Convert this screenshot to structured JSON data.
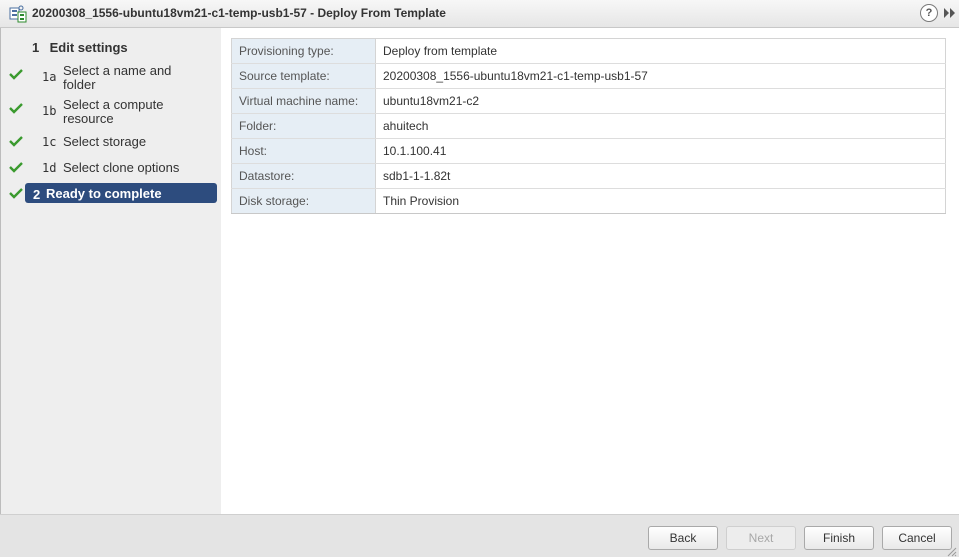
{
  "window": {
    "title": "20200308_1556-ubuntu18vm21-c1-temp-usb1-57 - Deploy From Template",
    "help_label": "?"
  },
  "sidebar": {
    "group": {
      "number": "1",
      "label": "Edit settings"
    },
    "steps": [
      {
        "number": "1a",
        "label": "Select a name and folder",
        "completed": true
      },
      {
        "number": "1b",
        "label": "Select a compute resource",
        "completed": true
      },
      {
        "number": "1c",
        "label": "Select storage",
        "completed": true
      },
      {
        "number": "1d",
        "label": "Select clone options",
        "completed": true
      },
      {
        "number": "2",
        "label": "Ready to complete",
        "completed": true,
        "active": true
      }
    ]
  },
  "summary": {
    "rows": [
      {
        "key": "Provisioning type:",
        "value": "Deploy from template"
      },
      {
        "key": "Source template:",
        "value": "20200308_1556-ubuntu18vm21-c1-temp-usb1-57"
      },
      {
        "key": "Virtual machine name:",
        "value": "ubuntu18vm21-c2"
      },
      {
        "key": "Folder:",
        "value": "ahuitech"
      },
      {
        "key": "Host:",
        "value": "10.1.100.41"
      },
      {
        "key": "Datastore:",
        "value": "sdb1-1-1.82t"
      },
      {
        "key": "Disk storage:",
        "value": "Thin Provision"
      }
    ]
  },
  "footer": {
    "back": "Back",
    "next": "Next",
    "finish": "Finish",
    "cancel": "Cancel"
  },
  "colors": {
    "active_step": "#2d4c7e",
    "check": "#3a9a2e",
    "key_cell": "#e6eef5"
  }
}
